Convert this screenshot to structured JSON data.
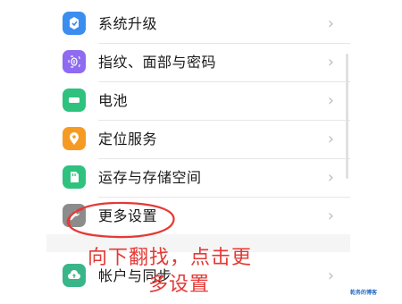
{
  "settings": {
    "items": [
      {
        "label": "系统升级",
        "icon": "system-update-icon",
        "color": "#3b8ef0"
      },
      {
        "label": "指纹、面部与密码",
        "icon": "fingerprint-face-icon",
        "color": "#8e6bf0"
      },
      {
        "label": "电池",
        "icon": "battery-icon",
        "color": "#2ec27e"
      },
      {
        "label": "定位服务",
        "icon": "location-icon",
        "color": "#f59b23"
      },
      {
        "label": "运存与存储空间",
        "icon": "storage-icon",
        "color": "#2ec27e"
      },
      {
        "label": "更多设置",
        "icon": "wrench-icon",
        "color": "#8c8c8c"
      },
      {
        "label": "帐户与同步",
        "icon": "cloud-sync-icon",
        "color": "#39b58a"
      }
    ],
    "chevron": "›"
  },
  "annotation": {
    "line1": "向下翻找，点击更",
    "line2": "多设置",
    "color": "#e53935"
  },
  "watermark": "乾务的博客"
}
